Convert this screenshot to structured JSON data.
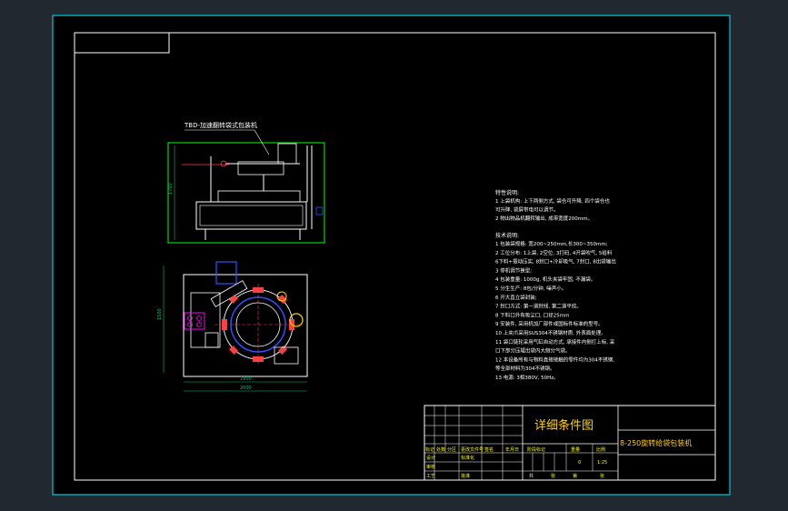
{
  "colors": {
    "background": "#212830",
    "sheet": "#000000",
    "border": "#00c8d8",
    "frame": "#ffffff",
    "outline": "#00ff00",
    "drawing": "#ffffff",
    "detail": "#ff4040",
    "accent": "#0000ff",
    "part_blue": "#3050ff",
    "part_magenta": "#ff00ff",
    "part_yellow": "#ffd000",
    "dimension": "#00c080",
    "title": "#ffd000",
    "table_text": "#ffff00",
    "table_line": "#ffffff"
  },
  "drawing": {
    "front_view_label": "TBD-加速翻转袋式包装机",
    "dim_height_front": "1700",
    "dim_depth_top": "1500",
    "dim_width_inner": "1800",
    "dim_width_outer": "2000"
  },
  "notes": {
    "process_heading": "特性说明:",
    "process_lines": [
      "1 上袋机构: 上下两侧方式, 袋仓可升降, 四个袋仓也",
      "  可升降, 袋屏带电可以调节。",
      "2 物出物品机翻转输出, 成带宽度200mm。"
    ],
    "tech_heading": "技术说明:",
    "tech_lines": [
      "1 包装袋规格: 宽200~250mm,长300~350mm;",
      "2 工位分布: 1上袋, 2空位, 3打码, 4开袋吹气, 5给料",
      "  6下料+振动压实, 8封口+冷却吸气, 7封口, 8出袋输出",
      "3 停机调节换型;",
      "4 包装重量: 1000g, 机头夹袋牢固, 不漏袋。",
      "5 分生生产: 8包/分钟, 噪声小。",
      "6 开大直立袋封装;",
      "7 封口方式: 第一道封线, 第二道平纹。",
      "8 下料口外有吸尘口, 口径25mm",
      "9 安装件, 采用机加厂部件或国标件标准的型号。",
      "10 上夹爪采用SUS304不锈钢材质, 外表面处理。",
      "11 袋口链轮采用气缸自动方式, 承接件内侧打上标, 采",
      "  口下部分压辊出袋内大侧分气袋。",
      "12 本设备所有与物料直接接触的零件均为304不锈钢,",
      "  等全部材料为304不锈钢。",
      "13 电源: 3相380V, 50Hz。"
    ]
  },
  "title_block": {
    "drawing_title": "详细条件图",
    "product_name": "8-250旋转给袋包装机",
    "row_labels_left": [
      "标记",
      "处数",
      "分区",
      "更改文件号",
      "签名",
      "年月日"
    ],
    "role_designer": "设计",
    "role_standard": "标准化",
    "role_reviewer": "审核",
    "role_process": "工艺",
    "role_approve": "批准",
    "stage_label": "阶段标记",
    "weight_label": "重量",
    "scale_label": "比例",
    "weight_value": "0",
    "scale_value": "1:25",
    "sheet_total_label": "共",
    "sheet_label": "张",
    "sheet_no_label": "第",
    "sheet_no_suffix": "张"
  }
}
